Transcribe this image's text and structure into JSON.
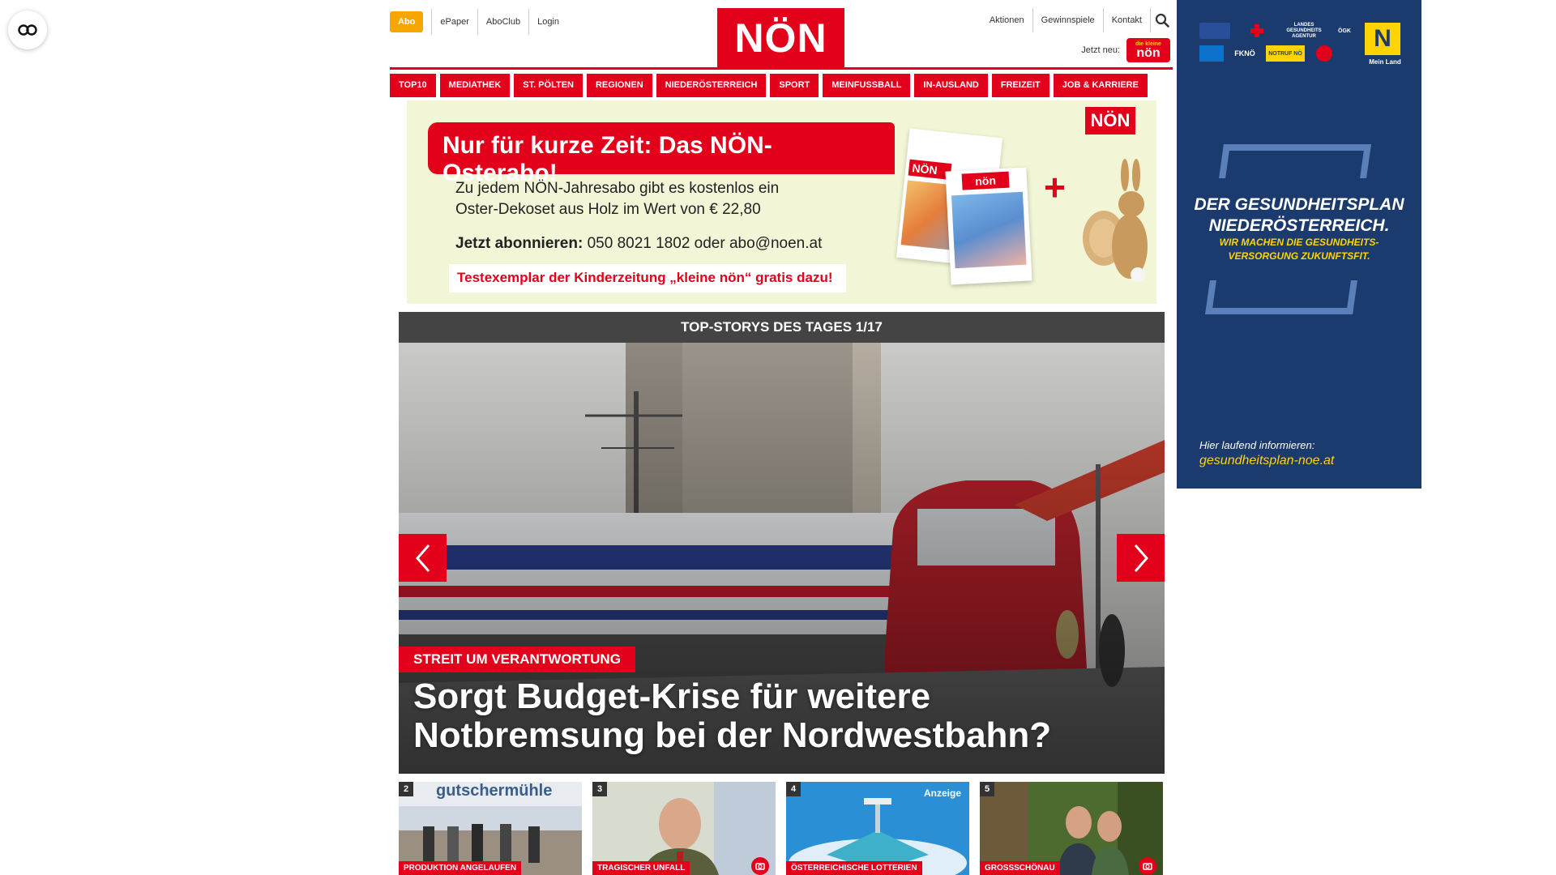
{
  "header": {
    "abo_label": "Abo",
    "top_left_links": [
      "ePaper",
      "AboClub",
      "Login"
    ],
    "logo_text": "NÖN",
    "top_right_links": [
      "Aktionen",
      "Gewinnspiele",
      "Kontakt"
    ],
    "jetzt_neu_label": "Jetzt neu:",
    "kleine_logo_small": "die kleine",
    "kleine_logo_text": "nön"
  },
  "nav": {
    "items": [
      "TOP10",
      "MEDIATHEK",
      "ST. PÖLTEN",
      "REGIONEN",
      "NIEDERÖSTERREICH",
      "SPORT",
      "MEINFUSSBALL",
      "IN-AUSLAND",
      "FREIZEIT",
      "JOB & KARRIERE"
    ]
  },
  "promo": {
    "headline": "Nur für kurze Zeit: Das NÖN-Osterabo!",
    "body_line1": "Zu jedem NÖN-Jahresabo gibt es kostenlos ein",
    "body_line2": "Oster-Dekoset aus Holz im Wert von € 22,80",
    "phone_label": "Jetzt abonnieren:",
    "phone_text": " 050 8021 1802 oder abo@noen.at",
    "free_text": "Testexemplar der Kinderzeitung „kleine nön“ gratis dazu!",
    "logo_text": "NÖN",
    "paper1_logo": "NÖN",
    "paper2_logo": "nön",
    "plus": "+"
  },
  "stories": {
    "bar_title": "TOP-STORYS DES TAGES 1/17",
    "hero_kicker": "STREIT UM VERANTWORTUNG",
    "hero_title": "Sorgt Budget-Krise für weitere Notbremsung bei der Nordwestbahn?",
    "thumbs": [
      {
        "num": "2",
        "kicker": "PRODUKTION ANGELAUFEN",
        "sign": "gutschermühle",
        "ad": ""
      },
      {
        "num": "3",
        "kicker": "TRAGISCHER UNFALL",
        "sign": "",
        "ad": ""
      },
      {
        "num": "4",
        "kicker": "ÖSTERREICHISCHE LOTTERIEN",
        "sign": "",
        "ad": "Anzeige"
      },
      {
        "num": "5",
        "kicker": "GROSSSCHÖNAU",
        "sign": "",
        "ad": ""
      }
    ]
  },
  "side_ad": {
    "title_line1": "DER GESUNDHEITSPLAN",
    "title_line2": "NIEDERÖSTERREICH.",
    "sub_line1": "WIR MACHEN DIE GESUNDHEITS-",
    "sub_line2": "VERSORGUNG ZUKUNFTSFIT.",
    "info": "Hier laufend informieren:",
    "link": "gesundheitsplan-noe.at",
    "noe_label": "Mein Land",
    "partner_logos": [
      "LANDES GESUNDHEITS AGENTUR",
      "NOTRUF NÖ",
      "ÖGK",
      "FKNÖ"
    ]
  },
  "colors": {
    "brand_red": "#e2001a",
    "abo_orange": "#f7a600",
    "ad_navy": "#1b3b6e",
    "ad_yellow": "#ffd400"
  },
  "icons": {
    "a11y": "accessibility-icon",
    "search": "search-icon",
    "prev": "chevron-left-icon",
    "next": "chevron-right-icon",
    "camera": "camera-icon"
  }
}
